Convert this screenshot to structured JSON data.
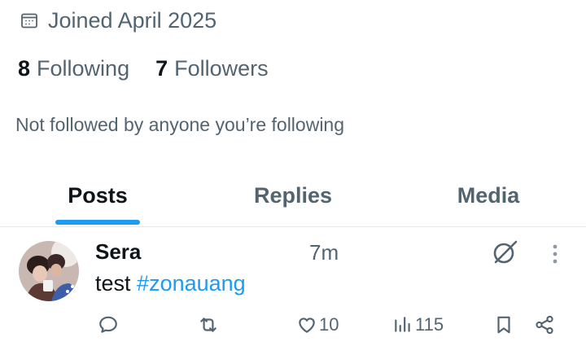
{
  "profile": {
    "joined_text": "Joined April 2025",
    "following_count": "8",
    "following_label": "Following",
    "followers_count": "7",
    "followers_label": "Followers",
    "not_followed_text": "Not followed by anyone you’re following"
  },
  "tabs": [
    {
      "label": "Posts",
      "active": true
    },
    {
      "label": "Replies",
      "active": false
    },
    {
      "label": "Media",
      "active": false
    }
  ],
  "post": {
    "author": "Sera",
    "time": "7m",
    "text_plain": "test",
    "hashtag": "#zonauang",
    "likes": "10",
    "views": "115",
    "icons": [
      "reply-icon",
      "repost-icon",
      "like-icon",
      "views-icon",
      "bookmark-icon",
      "share-icon",
      "grok-icon",
      "more-icon"
    ]
  },
  "colors": {
    "accent": "#1d9bf0",
    "text_primary": "#0f1419",
    "text_secondary": "#536471",
    "divider": "#e6e9eb"
  }
}
